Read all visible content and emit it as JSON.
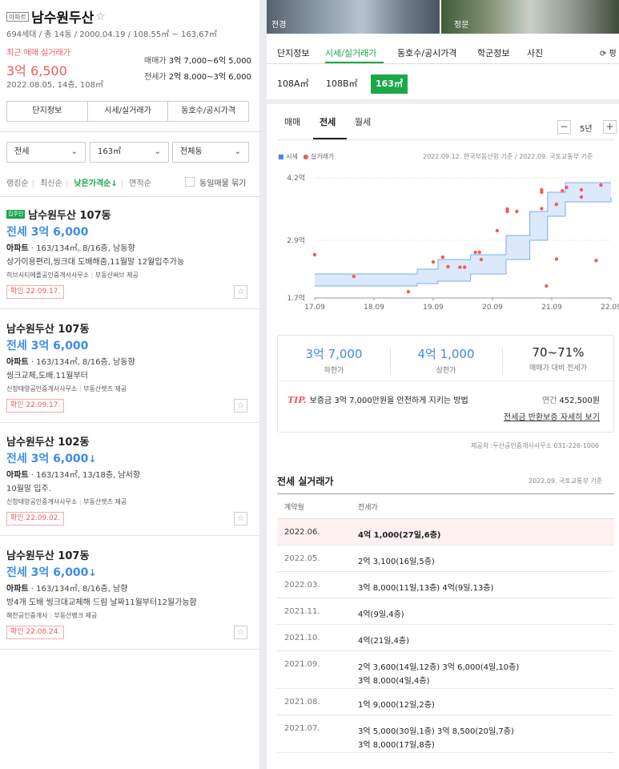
{
  "complex": {
    "badge": "아파트",
    "name": "남수원두산",
    "star": "☆",
    "info": "694세대 / 총 14동 / 2000.04.19 / 108.55㎡ ~ 163.67㎡",
    "recent_label": "최근 매매 실거래가",
    "recent_price": "3억 6,500",
    "recent_date": "2022.08.05, 14층, 108㎡",
    "sale_range_label": "매매가",
    "sale_range": "3억 7,000~6억 5,000",
    "rent_range_label": "전세가",
    "rent_range": "2억 8,000~3억 6,000"
  },
  "left_tabs": [
    "단지정보",
    "시세/실거래가",
    "동호수/공시가격"
  ],
  "filters": {
    "trade_type": "전세",
    "area": "163㎡",
    "building": "전체동",
    "chevron": "⌄"
  },
  "sort": {
    "items": [
      "랭킹순",
      "최신순",
      "낮은가격순↓",
      "면적순"
    ],
    "active_index": 2,
    "same_listing_label": "동일매물 묶기"
  },
  "listings": [
    {
      "owner_badge": "집주인",
      "title": "남수원두산 107동",
      "price": "전세 3억 6,000",
      "price_down": "",
      "type": "아파트",
      "spec": " · 163/134㎡, 8/16층, 남동향",
      "desc": "상가이용편리,씽크대 도배해줌,11월말 12월입주가능",
      "agent": "히브시티에플공인중개사사무소",
      "provider": "부동산써브 제공",
      "confirm": "확인 22.09.17.",
      "fav": "☆"
    },
    {
      "owner_badge": "",
      "title": "남수원두산 107동",
      "price": "전세 3억 6,000",
      "price_down": "",
      "type": "아파트",
      "spec": " · 163/134㎡, 8/16층, 남동향",
      "desc": "씽크교체,도배.11월부터",
      "agent": "신창태양공인중개사사무소",
      "provider": "부동산렛츠 제공",
      "confirm": "확인 22.09.17.",
      "fav": "☆"
    },
    {
      "owner_badge": "",
      "title": "남수원두산 102동",
      "price": "전세 3억 6,000",
      "price_down": "↓",
      "type": "아파트",
      "spec": " · 163/134㎡, 13/18층, 남서향",
      "desc": "10월말 입주.",
      "agent": "신창태양공인중개사사무소",
      "provider": "부동산렛츠 제공",
      "confirm": "확인 22.09.02.",
      "fav": "☆"
    },
    {
      "owner_badge": "",
      "title": "남수원두산 107동",
      "price": "전세 3억 6,000",
      "price_down": "↓",
      "type": "아파트",
      "spec": " · 163/134㎡, 8/16층, 남향",
      "desc": "방4개 도배 씽크대교체해 드림 날짜11월부터12월가능함",
      "agent": "해찬공인중개사",
      "provider": "부동산뱅크 제공",
      "confirm": "확인 22.08.24.",
      "fav": "☆"
    }
  ],
  "photos": {
    "left_label": "전경",
    "right_label": "정문"
  },
  "right_tabs": [
    "단지정보",
    "시세/실거래가",
    "동호수/공시가격",
    "학군정보",
    "사진"
  ],
  "right_tab_active": 1,
  "refresh_label": "⟳ 평",
  "sizes": [
    "108A㎡",
    "108B㎡",
    "163㎡"
  ],
  "size_active": 2,
  "deal_tabs": [
    "매매",
    "전세",
    "월세"
  ],
  "deal_tab_active": 1,
  "year_selector": {
    "minus": "−",
    "value": "5년",
    "plus": "+"
  },
  "legend": {
    "market": "시세",
    "actual": "실거래가",
    "square": "■",
    "dot": "●"
  },
  "chart_source": "2022.09.12. 한국부동산원 기준 / 2022.09. 국토교통부 기준",
  "chart_data": {
    "type": "scatter",
    "ylim": [
      1.7,
      4.2
    ],
    "yticks": [
      "4.2억",
      "2.9억",
      "1.7억"
    ],
    "ytick_values": [
      4.2,
      2.9,
      1.7
    ],
    "xticks": [
      "17.09",
      "18.09",
      "19.09",
      "20.09",
      "21.09",
      "22.09"
    ],
    "xtick_values": [
      2017.67,
      2018.67,
      2019.67,
      2020.67,
      2021.67,
      2022.67
    ],
    "colors": {
      "market_band": "#dbe9fb",
      "market_line": "#7aaee8",
      "actual_dot": "#f15a5a"
    },
    "market_band": {
      "x": [
        2017.67,
        2018.4,
        2019.4,
        2019.75,
        2020.3,
        2020.9,
        2021.3,
        2021.6,
        2021.9,
        2022.67
      ],
      "upper": [
        2.2,
        2.2,
        2.3,
        2.5,
        2.6,
        3.0,
        3.5,
        3.9,
        4.1,
        4.1
      ],
      "lower": [
        1.95,
        1.95,
        2.0,
        2.05,
        2.2,
        2.5,
        2.9,
        3.4,
        3.7,
        3.8
      ]
    },
    "actual_points": [
      {
        "x": 2017.67,
        "y": 2.6
      },
      {
        "x": 2018.33,
        "y": 2.15
      },
      {
        "x": 2019.25,
        "y": 1.83
      },
      {
        "x": 2019.67,
        "y": 2.45
      },
      {
        "x": 2019.83,
        "y": 2.55
      },
      {
        "x": 2019.92,
        "y": 2.35
      },
      {
        "x": 2020.12,
        "y": 2.34
      },
      {
        "x": 2020.2,
        "y": 2.34
      },
      {
        "x": 2020.38,
        "y": 2.65
      },
      {
        "x": 2020.45,
        "y": 2.65
      },
      {
        "x": 2020.48,
        "y": 2.5
      },
      {
        "x": 2020.75,
        "y": 3.1
      },
      {
        "x": 2020.92,
        "y": 3.5
      },
      {
        "x": 2020.92,
        "y": 3.55
      },
      {
        "x": 2021.08,
        "y": 3.5
      },
      {
        "x": 2021.5,
        "y": 3.9
      },
      {
        "x": 2021.5,
        "y": 3.95
      },
      {
        "x": 2021.5,
        "y": 3.56
      },
      {
        "x": 2021.58,
        "y": 1.95
      },
      {
        "x": 2021.75,
        "y": 3.65
      },
      {
        "x": 2021.75,
        "y": 2.51
      },
      {
        "x": 2021.85,
        "y": 3.93
      },
      {
        "x": 2021.92,
        "y": 4.0
      },
      {
        "x": 2022.17,
        "y": 3.8
      },
      {
        "x": 2022.17,
        "y": 3.95
      },
      {
        "x": 2022.42,
        "y": 2.48
      },
      {
        "x": 2022.5,
        "y": 4.05
      }
    ]
  },
  "stats": {
    "low_value": "3억 7,000",
    "low_label": "하한가",
    "high_value": "4억 1,000",
    "high_label": "상한가",
    "ratio_value": "70~71%",
    "ratio_label": "매매가 대비 전세가"
  },
  "tip": {
    "prefix": "TIP.",
    "text": "보증금 3억 7,000만원을 안전하게 지키는 방법",
    "annual_label": "연간",
    "annual_value": "452,500원",
    "more_link": "전세금 반환보증 자세히 보기"
  },
  "provider_text": "제공처 :두산공인중개사사무소 031-226-1006",
  "trades": {
    "title": "전세 실거래가",
    "source": "2022.09. 국토교통부 기준",
    "col_date": "계약월",
    "col_price": "전세가",
    "rows": [
      {
        "date": "2022.06.",
        "line1": "4억 1,000(27일,6층)",
        "line2": ""
      },
      {
        "date": "2022.05.",
        "line1": "2억 3,100(16일,5층)",
        "line2": ""
      },
      {
        "date": "2022.03.",
        "line1": "3억 8,000(11일,13층)    4억(9일,13층)",
        "line2": ""
      },
      {
        "date": "2021.11.",
        "line1": "4억(9일,4층)",
        "line2": ""
      },
      {
        "date": "2021.10.",
        "line1": "4억(21일,4층)",
        "line2": ""
      },
      {
        "date": "2021.09.",
        "line1": "2억 3,600(14일,12층)    3억 6,000(4일,10층)",
        "line2": "3억 8,000(4일,4층)"
      },
      {
        "date": "2021.08.",
        "line1": "1억 9,000(12일,2층)",
        "line2": ""
      },
      {
        "date": "2021.07.",
        "line1": "3억 5,000(30일,1층)    3억 8,500(20일,7층)",
        "line2": "3억 8,000(17일,8층)"
      }
    ]
  }
}
